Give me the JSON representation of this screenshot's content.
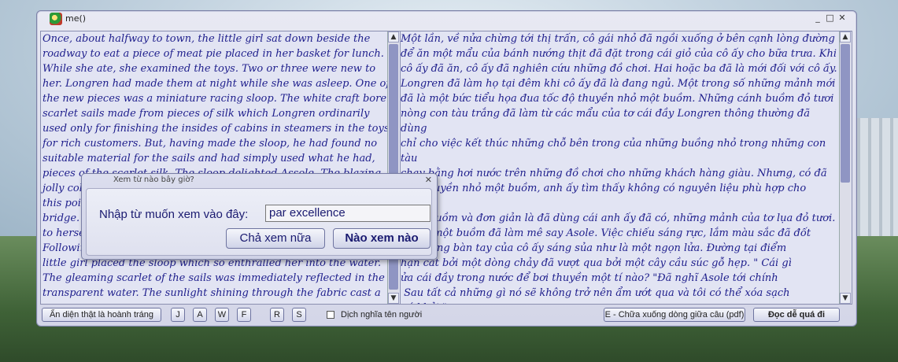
{
  "window": {
    "title": "me()",
    "buttons": [
      "_",
      "□",
      "✕"
    ]
  },
  "left_text": "Once, about halfway to town, the little girl sat down beside the\nroadway to eat a piece of meat pie placed in her basket for lunch.\nWhile she ate, she examined the toys. Two or three were new to\nher. Longren had made them at night while she was asleep. One of\nthe new pieces was a miniature racing sloop. The white craft bore\nscarlet sails made from pieces of silk which Longren ordinarily\nused only for finishing the insides of cabins in steamers in the toys\nfor rich customers. But, having made the sloop, he had found no\nsuitable material for the sails and had simply used what he had,\npieces of the scarlet silk. The sloop delighted Assole. The blazing\njolly colo\nthis poi\nbridge. \"\nto hersel\nFollowin\nlittle girl placed the sloop which so enthralled her into the water.\nThe gleaming scarlet of the sails was immediately reflected in the\ntransparent water. The sunlight shining through the fabric cast a",
  "right_text": "Một lần, về nửa chừng tới thị trấn, cô gái nhỏ đã ngồi xuống ở bên cạnh lòng đường\nđể ăn một mẩu của bánh nướng thịt đã đặt trong cái giỏ của cô ấy cho bữa trưa. Khi\ncô ấy đã ăn, cô ấy đã nghiên cứu những đồ chơi. Hai hoặc ba đã là mới đối với cô ấy.\nLongren đã làm họ tại đêm khi cô ấy đã là đang ngủ. Một trong số những mảnh mới\nđã là một bức tiểu họa đua tốc độ thuyền nhỏ một buồm. Những cánh buồm đỏ tươi\nnòng con tàu trắng đã làm từ các mẩu của tơ cái đầy Longren thông thường đã dùng\nchỉ cho việc kết thúc những chỗ bên trong của những buồng nhỏ trong những con tàu\nchạy bằng hơi nước trên những đồ chơi cho những khách hàng giàu. Nhưng, có đã\nlàm thuyền nhỏ một buồm, anh ấy tìm thấy không có nguyên liệu phù hợp cho những\ncánh buồm và đơn giản là đã dùng cái anh ấy đã có, những mảnh của tơ lụa đỏ tươi.\nn nhỏ một buồm đã làm mê say Asole. Việc chiếu sáng rực, lắm màu sắc đã đốt\nng những bàn tay của cô ấy sáng sủa như là một ngọn lửa. Đường tại điểm\nhận cắt bởi một dòng chảy đã vượt qua bởi một cây cầu súc gỗ hẹp. \" Cái gì\nửa cái đầy trong nước để bơi thuyền một tí nào? \"Đã nghĩ Asole tới chính\n Sau tất cả những gì nó sẽ không trở nên ẩm ướt qua và tôi có thể xóa sạch\nnó khỏi.\"\n\nĐi theo những khu rừng xuôi dòng một lối, tận bên kia cầu, cô gái nhỏ đã đặt thuyền",
  "bottom": {
    "btn_main": "Ẩn diện thật là hoành tráng",
    "btn_j": "J",
    "btn_a": "A",
    "btn_w": "W",
    "btn_f": "F",
    "btn_r": "R",
    "btn_s": "S",
    "checkbox_label": "Dịch nghĩa tên người",
    "btn_e": "E - Chữa xuống dòng giữa câu (pdf)",
    "btn_read": "Đọc dễ quá đi"
  },
  "dialog": {
    "title": "Xem từ nào bây giờ?",
    "close": "✕",
    "label": "Nhập từ muốn xem vào đây:",
    "input_value": "par excellence",
    "btn_cancel": "Chả xem nữa",
    "btn_ok": "Nào xem nào"
  }
}
